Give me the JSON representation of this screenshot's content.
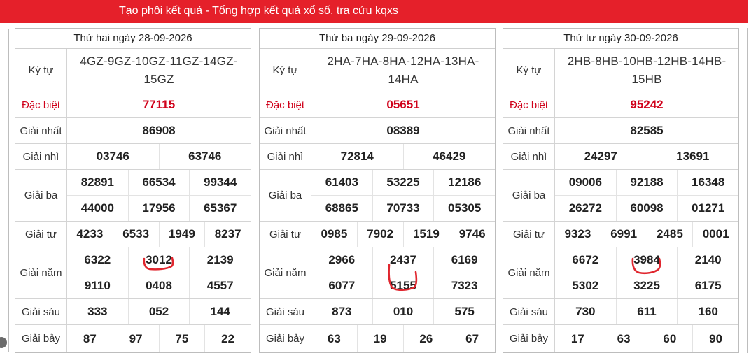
{
  "header": {
    "title": "Tạo phôi kết quả - Tổng hợp kết quả xổ số, tra cứu kqxs"
  },
  "labels": {
    "kytu": "Ký tự",
    "db": "Đặc biệt",
    "g1": "Giải nhất",
    "g2": "Giải nhì",
    "g3": "Giải ba",
    "g4": "Giải tư",
    "g5": "Giải năm",
    "g6": "Giải sáu",
    "g7": "Giải bảy"
  },
  "colors": {
    "brand_red": "#e5202a",
    "special_red": "#d0021b",
    "scribble_red": "#e0262e"
  },
  "panels": [
    {
      "date": "Thứ hai ngày 28-09-2026",
      "kytu": "4GZ-9GZ-10GZ-11GZ-14GZ-15GZ",
      "db": "77115",
      "g1": "86908",
      "g2": [
        "03746",
        "63746"
      ],
      "g3": [
        "82891",
        "66534",
        "99344",
        "44000",
        "17956",
        "65367"
      ],
      "g4": [
        "4233",
        "6533",
        "1949",
        "8237"
      ],
      "g5": [
        "6322",
        "3012",
        "2139",
        "9110",
        "0408",
        "4557"
      ],
      "g6": [
        "333",
        "052",
        "144"
      ],
      "g7": [
        "87",
        "97",
        "75",
        "22"
      ]
    },
    {
      "date": "Thứ ba ngày 29-09-2026",
      "kytu": "2HA-7HA-8HA-12HA-13HA-14HA",
      "db": "05651",
      "g1": "08389",
      "g2": [
        "72814",
        "46429"
      ],
      "g3": [
        "61403",
        "53225",
        "12186",
        "68865",
        "70733",
        "05305"
      ],
      "g4": [
        "0985",
        "7902",
        "1519",
        "9746"
      ],
      "g5": [
        "2966",
        "2437",
        "6169",
        "6077",
        "5155",
        "7323"
      ],
      "g6": [
        "873",
        "010",
        "575"
      ],
      "g7": [
        "63",
        "19",
        "26",
        "67"
      ]
    },
    {
      "date": "Thứ tư ngày 30-09-2026",
      "kytu": "2HB-8HB-10HB-12HB-14HB-15HB",
      "db": "95242",
      "g1": "82585",
      "g2": [
        "24297",
        "13691"
      ],
      "g3": [
        "09006",
        "92188",
        "16348",
        "26272",
        "60098",
        "01271"
      ],
      "g4": [
        "9323",
        "6991",
        "2485",
        "0001"
      ],
      "g5": [
        "6672",
        "3984",
        "2140",
        "5302",
        "3225",
        "6175"
      ],
      "g6": [
        "730",
        "611",
        "160"
      ],
      "g7": [
        "17",
        "63",
        "60",
        "90"
      ]
    }
  ]
}
